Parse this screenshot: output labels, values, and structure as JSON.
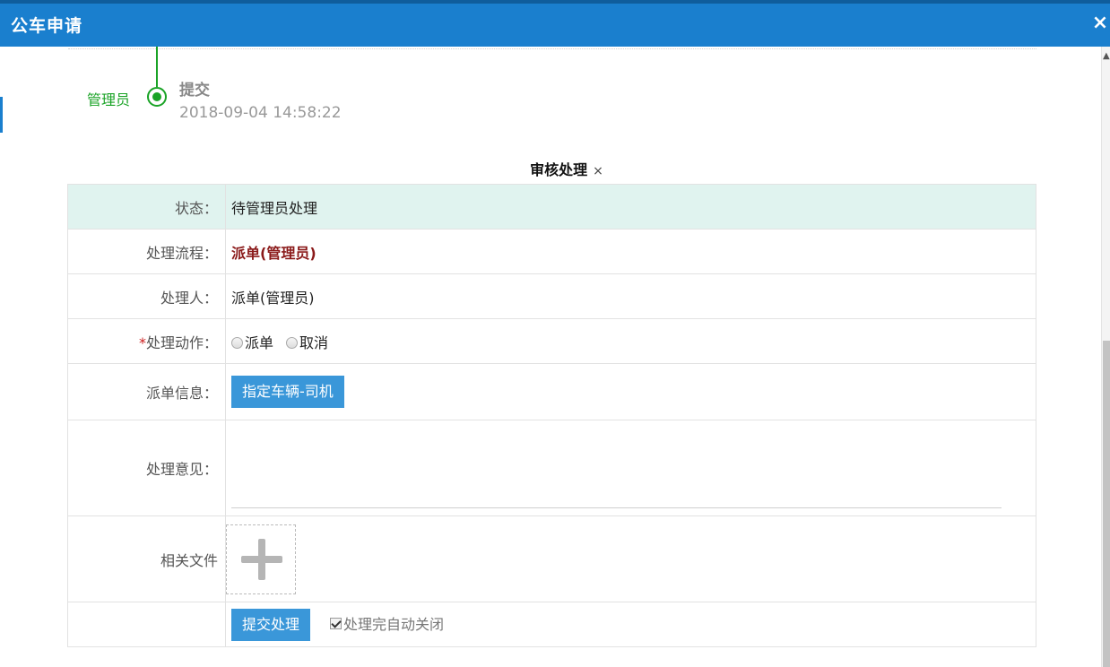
{
  "dialog": {
    "title": "公车申请",
    "close_symbol": "×"
  },
  "timeline": {
    "user": "管理员",
    "action": "提交",
    "time": "2018-09-04 14:58:22"
  },
  "section": {
    "title": "审核处理",
    "close_symbol": "×"
  },
  "form": {
    "status_label": "状态：",
    "status_value": "待管理员处理",
    "flow_label": "处理流程：",
    "flow_value": "派单(管理员)",
    "handler_label": "处理人：",
    "handler_value": "派单(管理员)",
    "action_required_mark": "*",
    "action_label": "处理动作：",
    "action_options": [
      "派单",
      "取消"
    ],
    "dispatch_label": "派单信息：",
    "dispatch_button": "指定车辆-司机",
    "comment_label": "处理意见：",
    "comment_value": "",
    "files_label": "相关文件",
    "submit_button": "提交处理",
    "auto_close_label": "处理完自动关闭",
    "auto_close_checked": true
  }
}
